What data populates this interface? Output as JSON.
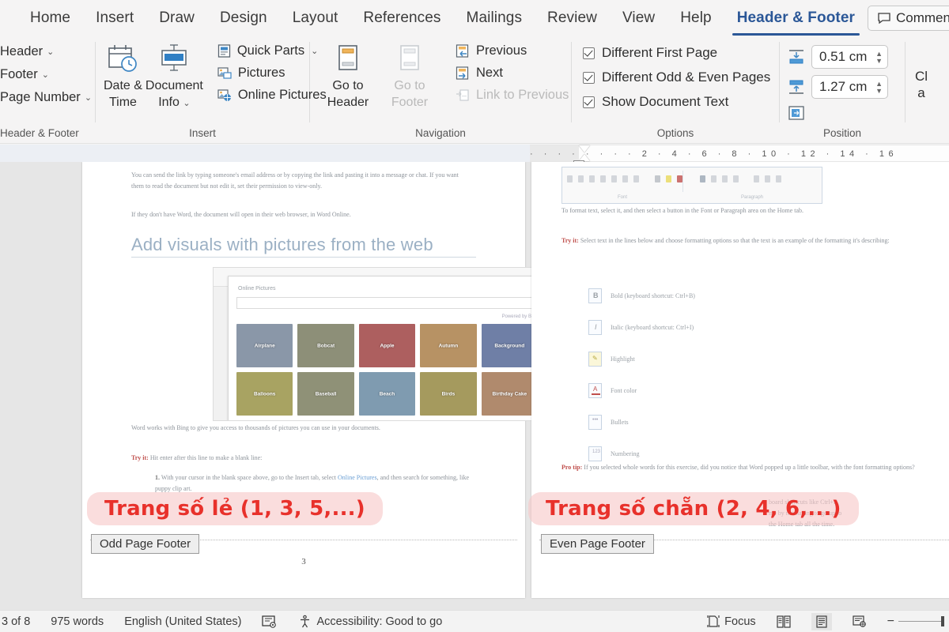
{
  "app": {
    "tabs": [
      {
        "label": "Home",
        "active": false
      },
      {
        "label": "Insert",
        "active": false
      },
      {
        "label": "Draw",
        "active": false
      },
      {
        "label": "Design",
        "active": false
      },
      {
        "label": "Layout",
        "active": false
      },
      {
        "label": "References",
        "active": false
      },
      {
        "label": "Mailings",
        "active": false
      },
      {
        "label": "Review",
        "active": false
      },
      {
        "label": "View",
        "active": false
      },
      {
        "label": "Help",
        "active": false
      },
      {
        "label": "Header & Footer",
        "active": true
      }
    ],
    "comments_label": "Comments"
  },
  "ribbon": {
    "header_footer_group": {
      "label": "Header & Footer",
      "items": [
        {
          "label": "Header",
          "caret": "⌄"
        },
        {
          "label": "Footer",
          "caret": "⌄"
        },
        {
          "label": "Page Number",
          "caret": "⌄"
        }
      ]
    },
    "insert_group": {
      "label": "Insert",
      "big_buttons": [
        {
          "label_line1": "Date &",
          "label_line2": "Time",
          "icon": "calendar-clock-icon"
        },
        {
          "label_line1": "Document",
          "label_line2": "Info",
          "icon": "document-info-icon",
          "caret": "⌄"
        }
      ],
      "small_buttons": [
        {
          "label": "Quick Parts",
          "icon": "quick-parts-icon",
          "caret": "⌄"
        },
        {
          "label": "Pictures",
          "icon": "pictures-icon"
        },
        {
          "label": "Online Pictures",
          "icon": "online-pictures-icon"
        }
      ]
    },
    "navigation_group": {
      "label": "Navigation",
      "big_buttons": [
        {
          "label_line1": "Go to",
          "label_line2": "Header",
          "icon": "go-to-header-icon",
          "disabled": false
        },
        {
          "label_line1": "Go to",
          "label_line2": "Footer",
          "icon": "go-to-footer-icon",
          "disabled": true
        }
      ],
      "small_buttons": [
        {
          "label": "Previous",
          "icon": "previous-icon",
          "disabled": false
        },
        {
          "label": "Next",
          "icon": "next-icon",
          "disabled": false
        },
        {
          "label": "Link to Previous",
          "icon": "link-to-previous-icon",
          "disabled": true
        }
      ]
    },
    "options_group": {
      "label": "Options",
      "checkboxes": [
        {
          "label": "Different First Page",
          "checked": true
        },
        {
          "label": "Different Odd & Even Pages",
          "checked": true
        },
        {
          "label": "Show Document Text",
          "checked": true
        }
      ]
    },
    "position_group": {
      "label": "Position",
      "fields": [
        {
          "icon": "header-from-top-icon",
          "value": "0.51 cm"
        },
        {
          "icon": "footer-from-bottom-icon",
          "value": "1.27 cm"
        }
      ],
      "insert_alignment_tab": {
        "icon": "insert-alignment-tab-icon"
      }
    },
    "close_group": {
      "label_line1": "Cl",
      "label_line2": "a"
    }
  },
  "ruler": {
    "ticks": "· · · · · · ·  ·  2  ·  4  ·  6  ·  8  · 10 · 12 · 14 · 16"
  },
  "document": {
    "left_page": {
      "paragraphs": [
        "You can send the link by typing someone's email address or by copying the link and pasting it into a message or chat. If you want them to read the document but not edit it, set their permission to view-only.",
        "If they don't have Word, the document will open in their web browser, in Word Online."
      ],
      "heading": "Add visuals with pictures from the web",
      "screenshot": {
        "dialog_title": "Online Pictures",
        "powered_by": "Powered by Bing",
        "tiles": [
          {
            "label": "Airplane",
            "color": "#8a97a8"
          },
          {
            "label": "Bobcat",
            "color": "#8d8f78"
          },
          {
            "label": "Apple",
            "color": "#ad5f5f"
          },
          {
            "label": "Autumn",
            "color": "#b79264"
          },
          {
            "label": "Background",
            "color": "#6f7fa6"
          },
          {
            "label": "Balloons",
            "color": "#a8a362"
          },
          {
            "label": "Baseball",
            "color": "#8f9177"
          },
          {
            "label": "Beach",
            "color": "#7f9bb0"
          },
          {
            "label": "Birds",
            "color": "#a59a5e"
          },
          {
            "label": "Birthday Cake",
            "color": "#b08a6d"
          }
        ]
      },
      "body_after": "Word works with Bing to give you access to thousands of pictures you can use in your documents.",
      "tryit_label": "Try it:",
      "tryit_text": "Hit enter after this line to make a blank line:",
      "list_number": "1.",
      "list_text_a": "With your cursor in the blank space above, go to the Insert tab, select ",
      "list_link": "Online Pictures",
      "list_text_b": ", and then search for something, like puppy clip art.",
      "footer_page_number": "3"
    },
    "right_page": {
      "paragraphs": [
        "To format text, select it, and then select a button in the Font or Paragraph area on the Home tab."
      ],
      "link_font": "Font",
      "link_paragraph": "Paragraph",
      "tryit_label": "Try it:",
      "tryit_text": "Select text in the lines below and choose formatting options so that the text is an example of the formatting it's describing:",
      "format_items": [
        {
          "glyph": "B",
          "label": "Bold (keyboard shortcut: Ctrl+B)"
        },
        {
          "glyph": "I",
          "label": "Italic (keyboard shortcut: Ctrl+I)"
        },
        {
          "glyph": "✐",
          "label": "Highlight"
        },
        {
          "glyph": "A",
          "label": "Font color"
        },
        {
          "glyph": "≡",
          "label": "Bullets"
        },
        {
          "glyph": "≣",
          "label": "Numbering"
        }
      ],
      "protip_label": "Pro tip:",
      "protip_text": "If you selected whole words for this exercise, did you notice that Word popped up a little toolbar, with the font formatting options?",
      "tail_line1": "board shortcuts like Ctrl+B",
      "tail_line2": "me by not having to go up to",
      "tail_line3": "the Home tab all the time.",
      "toolbar_labels": [
        "Font",
        "Paragraph"
      ]
    }
  },
  "annotations": {
    "odd": "Trang số lẻ (1, 3, 5,...)",
    "even": "Trang số chẵn (2, 4, 6,...)",
    "odd_color": "#e8312b",
    "even_color": "#e8312b"
  },
  "footer_tabs": {
    "odd": "Odd Page Footer",
    "even": "Even Page Footer"
  },
  "status_bar": {
    "page_indicator": "3 of 8",
    "word_count": "975 words",
    "language": "English (United States)",
    "accessibility": "Accessibility: Good to go",
    "focus": "Focus",
    "proofing_icon": "proofing-icon",
    "accessibility_icon": "accessibility-icon",
    "focus_icon": "focus-icon",
    "view_read_icon": "read-mode-icon",
    "view_print_icon": "print-layout-icon",
    "view_web_icon": "web-layout-icon"
  }
}
